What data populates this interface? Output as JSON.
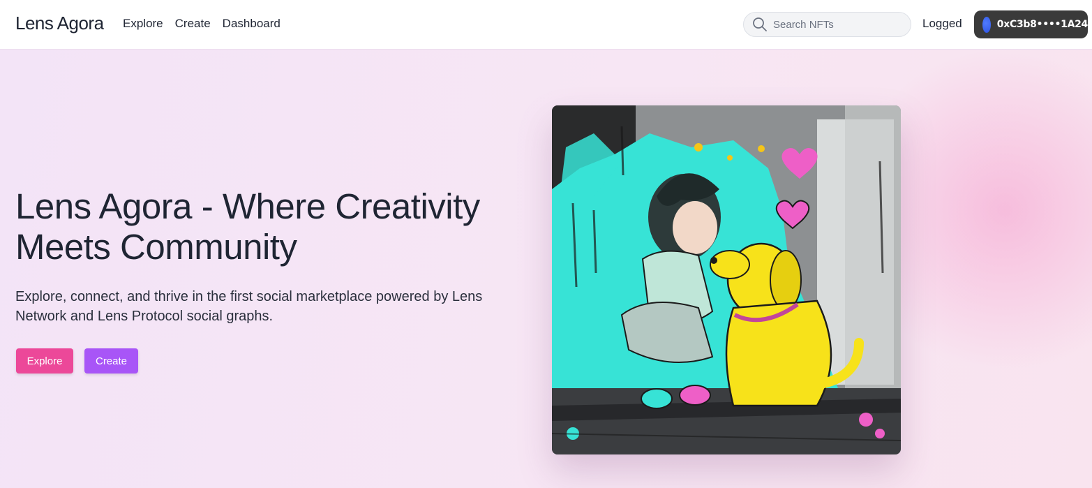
{
  "nav": {
    "brand": "Lens Agora",
    "links": [
      "Explore",
      "Create",
      "Dashboard"
    ],
    "search_placeholder": "Search NFTs",
    "status": "Logged",
    "wallet_address": "0xC3b8••••1A24"
  },
  "hero": {
    "title": "Lens Agora - Where Creativity Meets Community",
    "subtitle": "Explore, connect, and thrive in the first social marketplace powered by Lens Network and Lens Protocol social graphs.",
    "buttons": {
      "explore": "Explore",
      "create": "Create"
    },
    "image_subject": "girl-and-dog-artwork"
  },
  "colors": {
    "explore_button": "#ec4899",
    "create_button": "#a855f7",
    "wallet_bg": "#3a3a3a",
    "wallet_avatar": "#3b63f5",
    "hero_bg": "#f5e6f6"
  }
}
